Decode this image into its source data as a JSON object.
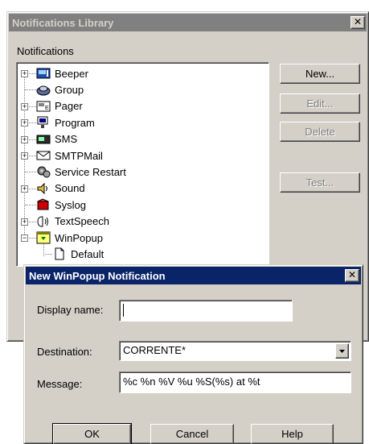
{
  "library": {
    "title": "Notifications Library",
    "group_label": "Notifications",
    "tree": [
      {
        "label": "Beeper",
        "icon": "beeper-icon",
        "expandable": true
      },
      {
        "label": "Group",
        "icon": "group-icon",
        "expandable": false
      },
      {
        "label": "Pager",
        "icon": "pager-icon",
        "expandable": true
      },
      {
        "label": "Program",
        "icon": "program-icon",
        "expandable": true
      },
      {
        "label": "SMS",
        "icon": "sms-icon",
        "expandable": true
      },
      {
        "label": "SMTPMail",
        "icon": "mail-icon",
        "expandable": true
      },
      {
        "label": "Service Restart",
        "icon": "service-restart-icon",
        "expandable": false
      },
      {
        "label": "Sound",
        "icon": "sound-icon",
        "expandable": true
      },
      {
        "label": "Syslog",
        "icon": "syslog-icon",
        "expandable": false
      },
      {
        "label": "TextSpeech",
        "icon": "text-speech-icon",
        "expandable": true
      },
      {
        "label": "WinPopup",
        "icon": "winpopup-icon",
        "expandable": true,
        "expanded": true
      },
      {
        "label": "Default",
        "icon": "document-icon",
        "child": true
      }
    ],
    "buttons": {
      "new": "New...",
      "edit": "Edit...",
      "delete": "Delete",
      "test": "Test..."
    },
    "expand_glyph": "+",
    "collapse_glyph": "−"
  },
  "dialog": {
    "title": "New WinPopup Notification",
    "display_name_label": "Display name:",
    "display_name_value": "",
    "destination_label": "Destination:",
    "destination_value": "CORRENTE*",
    "message_label": "Message:",
    "message_value": "%c %n %V %u %S(%s) at %t",
    "buttons": {
      "ok": "OK",
      "cancel": "Cancel",
      "help": "Help"
    }
  },
  "colors": {
    "active_title": "#0a246a",
    "inactive_title": "#808080",
    "face": "#d4d0c8"
  }
}
